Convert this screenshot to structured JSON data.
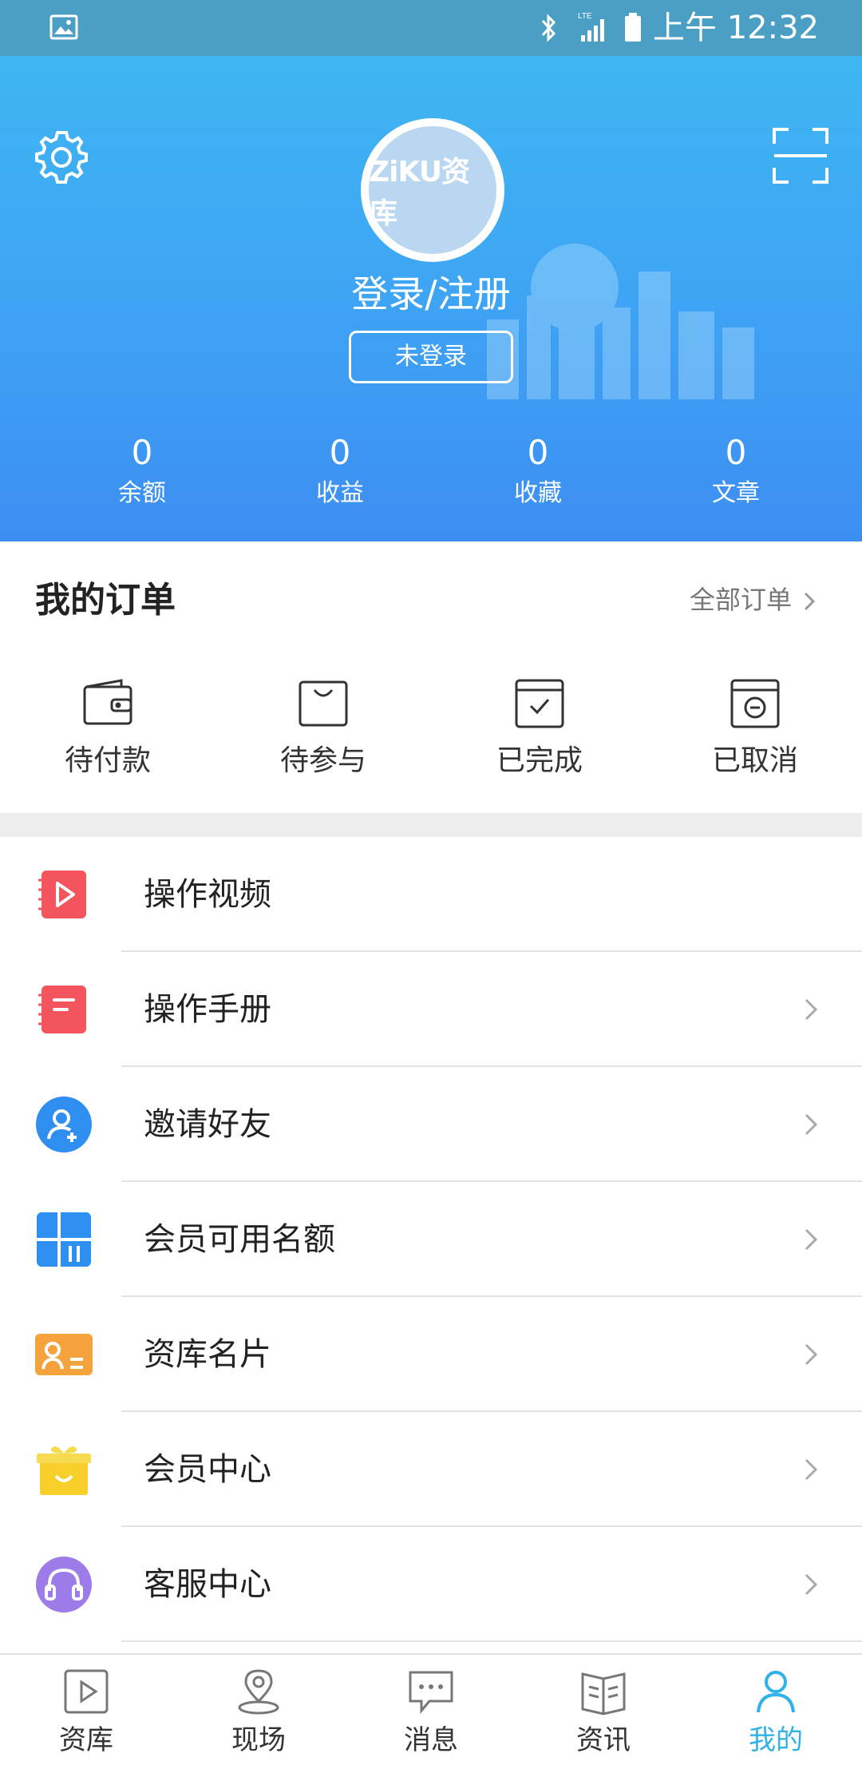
{
  "status_bar": {
    "time": "上午 12:32",
    "network": "LTE"
  },
  "header": {
    "avatar_text": "ZiKU资库",
    "login_text": "登录/注册",
    "login_status": "未登录",
    "stats": [
      {
        "value": "0",
        "label": "余额"
      },
      {
        "value": "0",
        "label": "收益"
      },
      {
        "value": "0",
        "label": "收藏"
      },
      {
        "value": "0",
        "label": "文章"
      }
    ]
  },
  "orders": {
    "title": "我的订单",
    "all_label": "全部订单",
    "items": [
      {
        "label": "待付款",
        "icon": "wallet-icon"
      },
      {
        "label": "待参与",
        "icon": "bag-icon"
      },
      {
        "label": "已完成",
        "icon": "completed-icon"
      },
      {
        "label": "已取消",
        "icon": "cancelled-icon"
      }
    ]
  },
  "menu": [
    {
      "label": "操作视频",
      "icon": "video-icon",
      "color": "#f4545e"
    },
    {
      "label": "操作手册",
      "icon": "manual-icon",
      "color": "#f4545e"
    },
    {
      "label": "邀请好友",
      "icon": "invite-icon",
      "color": "#2f8ff0"
    },
    {
      "label": "会员可用名额",
      "icon": "quota-icon",
      "color": "#2f8ff0"
    },
    {
      "label": "资库名片",
      "icon": "card-icon",
      "color": "#f4a23c"
    },
    {
      "label": "会员中心",
      "icon": "gift-icon",
      "color": "#f8cf2a"
    },
    {
      "label": "客服中心",
      "icon": "headset-icon",
      "color": "#9d7be8"
    }
  ],
  "bottom_nav": [
    {
      "label": "资库",
      "icon": "play-icon",
      "active": false
    },
    {
      "label": "现场",
      "icon": "location-icon",
      "active": false
    },
    {
      "label": "消息",
      "icon": "message-icon",
      "active": false
    },
    {
      "label": "资讯",
      "icon": "book-icon",
      "active": false
    },
    {
      "label": "我的",
      "icon": "person-icon",
      "active": true
    }
  ],
  "colors": {
    "header_top": "#3fb6f2",
    "header_bottom": "#3d8ef2",
    "active_tab": "#2fb2e8",
    "status_bar": "#4b9fc4"
  }
}
